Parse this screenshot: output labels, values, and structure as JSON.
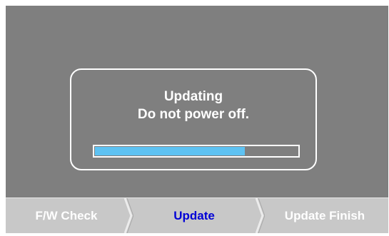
{
  "dialog": {
    "line1": "Updating",
    "line2": "Do not power off.",
    "progress": 0.74
  },
  "steps": [
    {
      "label": "F/W Check",
      "active": false
    },
    {
      "label": "Update",
      "active": true
    },
    {
      "label": "Update Finish",
      "active": false
    }
  ],
  "colors": {
    "screen_bg": "#7f7f7f",
    "progress_fill": "#5ec2f2",
    "active_step_text": "#0000d6",
    "step_bar_bg": "#c8c8c8"
  },
  "icons": {
    "step_separator": "chevron-right-icon"
  }
}
